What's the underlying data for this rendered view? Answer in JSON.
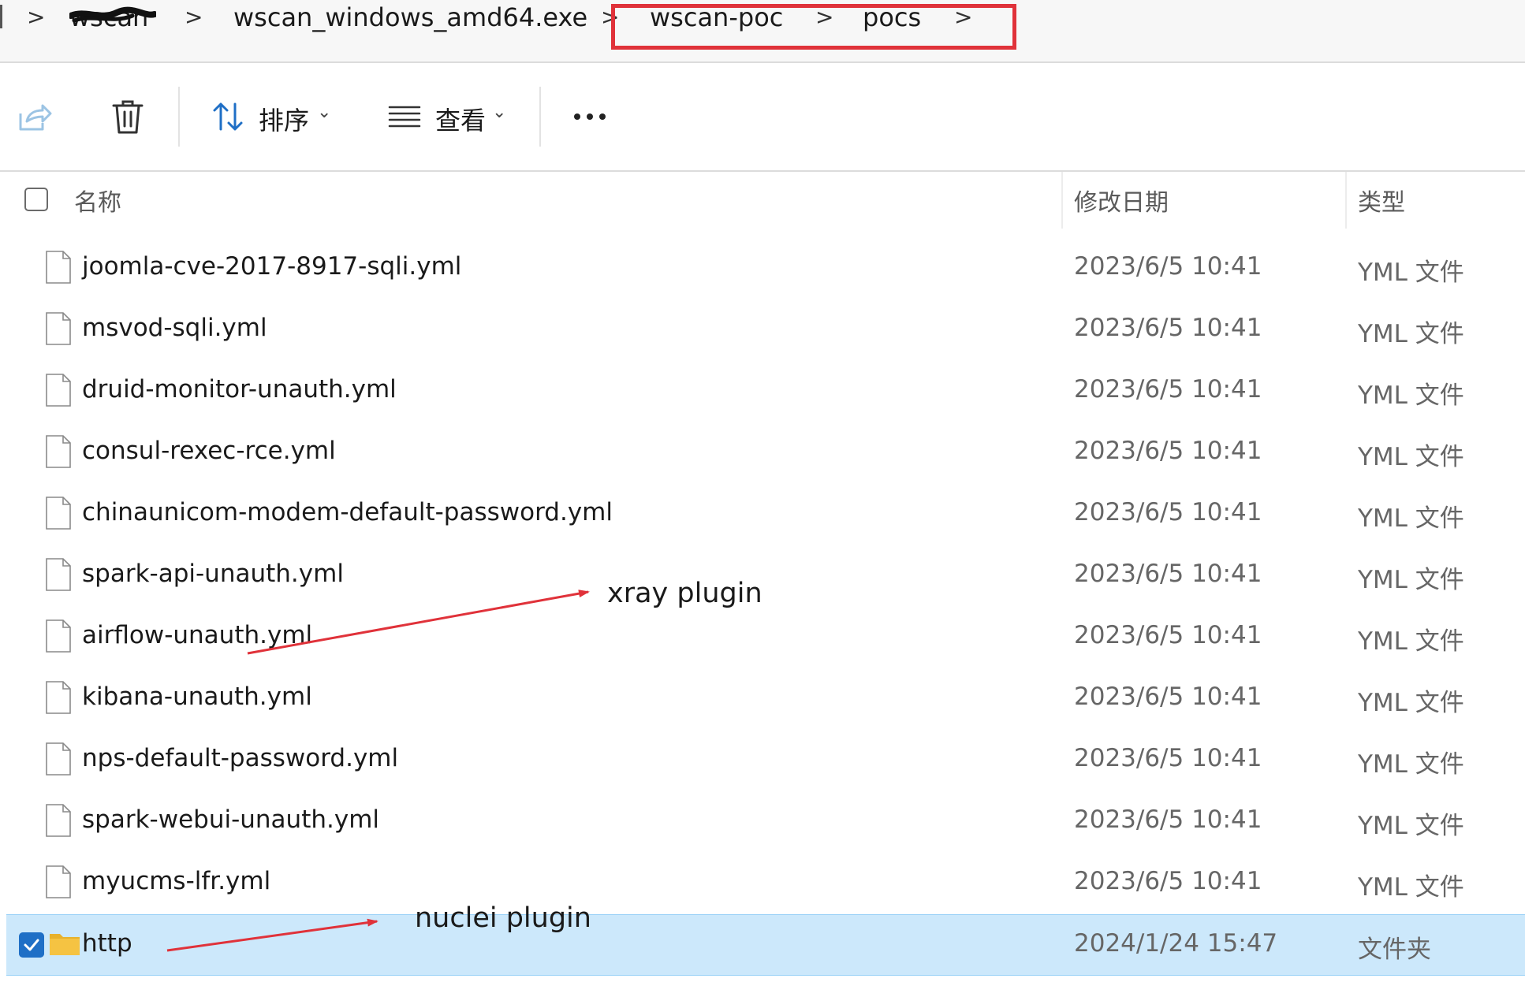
{
  "breadcrumb": {
    "items": [
      "wscan",
      "wscan_windows_amd64.exe",
      "wscan-poc",
      "pocs"
    ],
    "separator": ">"
  },
  "toolbar": {
    "sort_label": "排序",
    "view_label": "查看",
    "more_label": "..."
  },
  "columns": {
    "name": "名称",
    "modified": "修改日期",
    "type": "类型"
  },
  "files": [
    {
      "name": "joomla-cve-2017-8917-sqli.yml",
      "modified": "2023/6/5 10:41",
      "type": "YML 文件"
    },
    {
      "name": "msvod-sqli.yml",
      "modified": "2023/6/5 10:41",
      "type": "YML 文件"
    },
    {
      "name": "druid-monitor-unauth.yml",
      "modified": "2023/6/5 10:41",
      "type": "YML 文件"
    },
    {
      "name": "consul-rexec-rce.yml",
      "modified": "2023/6/5 10:41",
      "type": "YML 文件"
    },
    {
      "name": "chinaunicom-modem-default-password.yml",
      "modified": "2023/6/5 10:41",
      "type": "YML 文件"
    },
    {
      "name": "spark-api-unauth.yml",
      "modified": "2023/6/5 10:41",
      "type": "YML 文件"
    },
    {
      "name": "airflow-unauth.yml",
      "modified": "2023/6/5 10:41",
      "type": "YML 文件"
    },
    {
      "name": "kibana-unauth.yml",
      "modified": "2023/6/5 10:41",
      "type": "YML 文件"
    },
    {
      "name": "nps-default-password.yml",
      "modified": "2023/6/5 10:41",
      "type": "YML 文件"
    },
    {
      "name": "spark-webui-unauth.yml",
      "modified": "2023/6/5 10:41",
      "type": "YML 文件"
    },
    {
      "name": "myucms-lfr.yml",
      "modified": "2023/6/5 10:41",
      "type": "YML 文件"
    }
  ],
  "folder": {
    "name": "http",
    "modified": "2024/1/24 15:47",
    "type": "文件夹",
    "selected": true
  },
  "annotations": {
    "xray": "xray plugin",
    "nuclei": "nuclei plugin"
  },
  "colors": {
    "highlight_box": "#e0323a",
    "arrow": "#e0323a",
    "selected_row": "#cce8fb",
    "accent_blue": "#1f6fc6",
    "folder_yellow": "#f5c342"
  },
  "icons": {
    "share": "share-icon",
    "delete": "trash-icon",
    "sort": "sort-arrows-icon",
    "view": "view-list-icon",
    "more": "more-dots-icon",
    "file": "file-icon",
    "folder": "folder-icon",
    "check": "checkbox-checked-icon"
  }
}
